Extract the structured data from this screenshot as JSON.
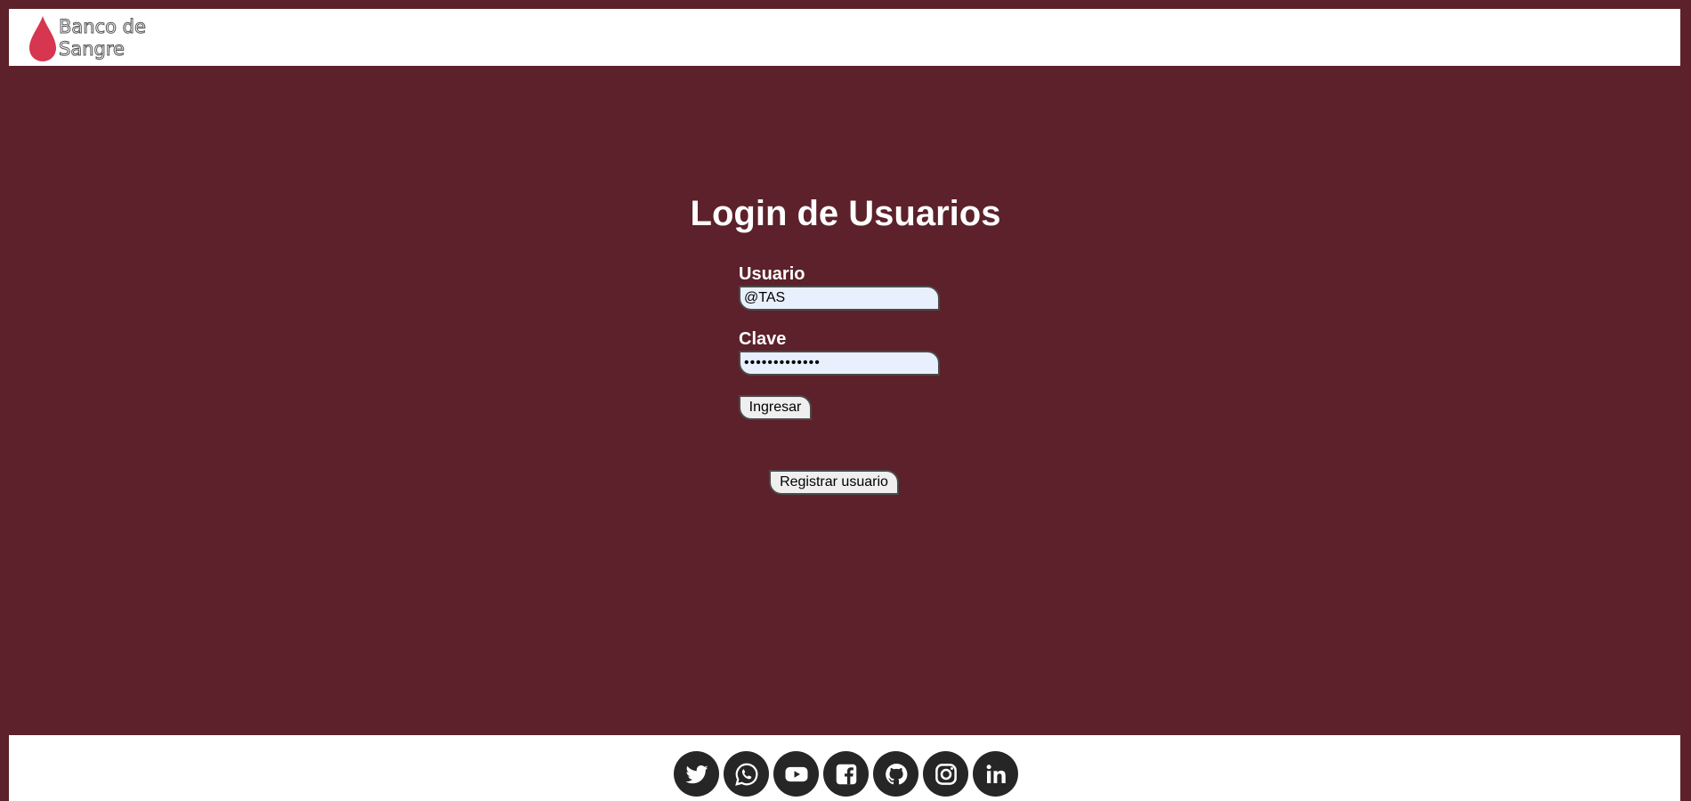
{
  "brand": {
    "name_line1": "Banco de",
    "name_line2": "Sangre",
    "drop_color": "#d6364f"
  },
  "theme": {
    "background": "#5c212a",
    "input_background": "#e8f0fe"
  },
  "login": {
    "title": "Login de Usuarios",
    "user_label": "Usuario",
    "user_value": "@TAS",
    "password_label": "Clave",
    "password_value": "•••••••••••••",
    "submit_label": "Ingresar",
    "register_label": "Registrar usuario"
  },
  "footer": {
    "social": [
      {
        "icon": "twitter-icon"
      },
      {
        "icon": "whatsapp-icon"
      },
      {
        "icon": "youtube-icon"
      },
      {
        "icon": "facebook-icon"
      },
      {
        "icon": "github-icon"
      },
      {
        "icon": "instagram-icon"
      },
      {
        "icon": "linkedin-icon"
      }
    ]
  }
}
